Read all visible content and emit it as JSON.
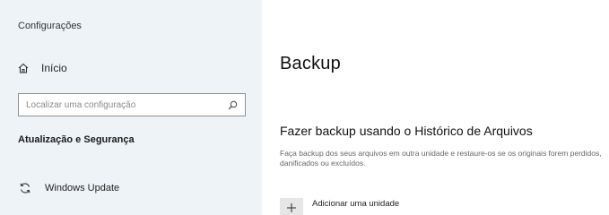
{
  "sidebar": {
    "app_title": "Configurações",
    "home_label": "Início",
    "search_placeholder": "Localizar uma configuração",
    "section_header": "Atualização e Segurança",
    "items": [
      {
        "label": "Windows Update",
        "icon": "sync-icon"
      }
    ]
  },
  "main": {
    "page_title": "Backup",
    "section_title": "Fazer backup usando o Histórico de Arquivos",
    "description": "Faça backup dos seus arquivos em outra unidade e restaure-os se os originais forem perdidos, danificados ou excluídos.",
    "add_drive_label": "Adicionar uma unidade"
  },
  "colors": {
    "sidebar_bg": "#eef3f8",
    "main_bg": "#ffffff",
    "tile_bg": "#e6e6e6"
  },
  "icons": {
    "home": "home-icon",
    "search": "search-icon",
    "update": "sync-icon",
    "add": "plus-icon"
  }
}
